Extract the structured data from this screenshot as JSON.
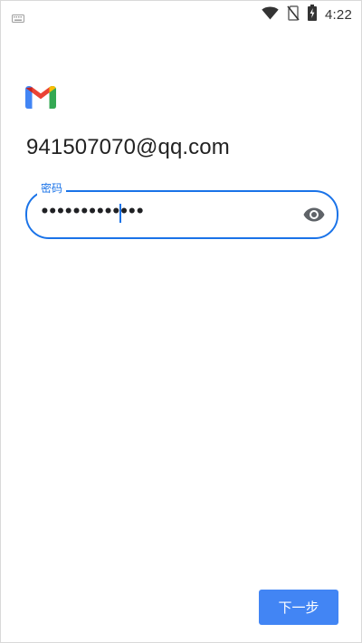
{
  "status_bar": {
    "time": "4:22",
    "icons": [
      "keyboard-icon",
      "wifi-icon",
      "no-sim-icon",
      "battery-charging-icon"
    ]
  },
  "app": {
    "logo": "gmail-icon"
  },
  "account": {
    "email": "941507070@qq.com"
  },
  "password_field": {
    "label": "密码",
    "value": "•••••••••••••",
    "toggle_icon": "eye-icon"
  },
  "actions": {
    "next_label": "下一步"
  },
  "colors": {
    "accent": "#1a73e8",
    "button": "#4285f4",
    "text": "#222222"
  }
}
